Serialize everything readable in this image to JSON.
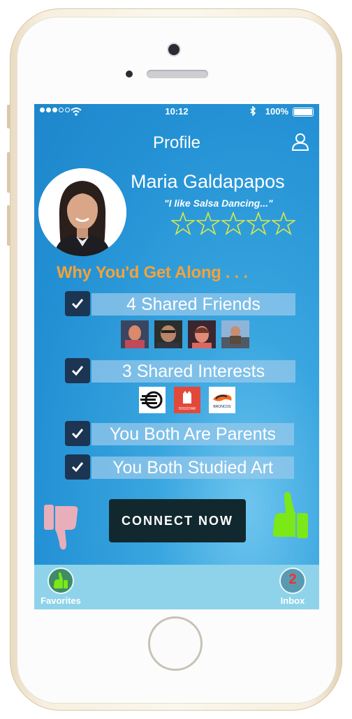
{
  "status_bar": {
    "time": "10:12",
    "battery": "100%"
  },
  "header": {
    "title": "Profile"
  },
  "profile": {
    "name": "Maria Galdapapos",
    "quote": "\"I like Salsa Dancing...\"",
    "rating_stars": 5,
    "rating_filled": 0
  },
  "section_heading": "Why You'd Get Along . . .",
  "reasons": [
    {
      "label": "4 Shared Friends",
      "checked": true
    },
    {
      "label": "3 Shared Interests",
      "checked": true
    },
    {
      "label": "You Both Are Parents",
      "checked": true
    },
    {
      "label": "You Both Studied Art",
      "checked": true
    }
  ],
  "interest_logos": [
    {
      "name": "logo-dodge",
      "text": ""
    },
    {
      "name": "logo-dogstar",
      "text": "DOGSTAR"
    },
    {
      "name": "logo-broncos",
      "text": "BRONCOS"
    }
  ],
  "actions": {
    "connect_label": "CONNECT NOW",
    "dislike_icon": "thumbs-down-icon",
    "like_icon": "thumbs-up-icon"
  },
  "tabs": {
    "favorites_label": "Favorites",
    "inbox_label": "Inbox",
    "inbox_count": "2"
  },
  "colors": {
    "screen_blue": "#2391d4",
    "heading_orange": "#f4a23a",
    "check_navy": "#1b3552",
    "thumbs_down": "#e8aeb9",
    "thumbs_up": "#7be817",
    "connect_bg": "#11292e",
    "star_outline": "#d8e84a"
  }
}
